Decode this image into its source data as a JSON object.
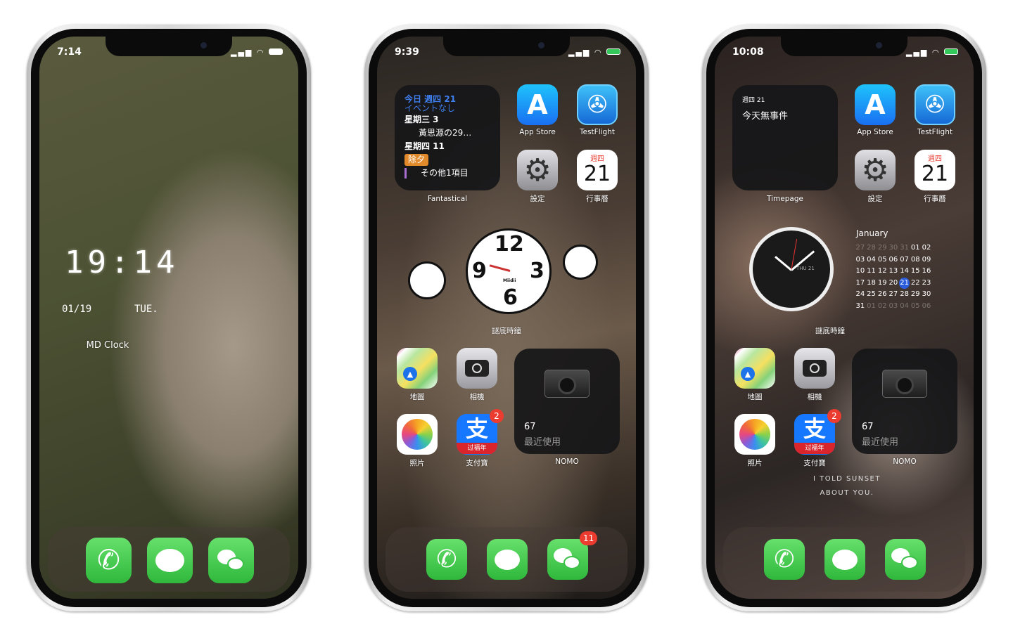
{
  "phones": [
    {
      "status_time": "7:14",
      "md_clock": {
        "time": "19:14",
        "date": "01/19",
        "weekday": "TUE.",
        "label": "MD Clock"
      },
      "dock": [
        {
          "icon": "phone-icon"
        },
        {
          "icon": "messages-icon"
        },
        {
          "icon": "wechat-icon"
        }
      ]
    },
    {
      "status_time": "9:39",
      "fantastical": {
        "today": "今日 週四 21",
        "no_events": "イベントなし",
        "day1": "星期三 3",
        "event1": "黃思源の29…",
        "day2": "星期四 11",
        "event2": "除夕",
        "more": "その他1項目",
        "label": "Fantastical"
      },
      "apps": {
        "appstore": "App Store",
        "testflight": "TestFlight",
        "settings": "設定",
        "calendar": "行事曆",
        "maps": "地圖",
        "camera": "相機",
        "photos": "照片",
        "alipay": "支付寶"
      },
      "calendar_icon": {
        "weekday": "週四",
        "day": "21"
      },
      "alipay_banner": "过福年",
      "alipay_badge": "2",
      "clock": {
        "label": "謎底時鐘",
        "brand": "Miidii",
        "n12": "12",
        "n3": "3",
        "n6": "6",
        "n9": "9"
      },
      "nomo": {
        "count": "67",
        "subtitle": "最近使用",
        "label": "NOMO"
      },
      "dock_badge": "11"
    },
    {
      "status_time": "10:08",
      "timepage": {
        "date": "週四 21",
        "text": "今天無事件",
        "label": "Timepage"
      },
      "apps": {
        "appstore": "App Store",
        "testflight": "TestFlight",
        "settings": "設定",
        "calendar": "行事曆",
        "maps": "地圖",
        "camera": "相機",
        "photos": "照片",
        "alipay": "支付寶"
      },
      "calendar_icon": {
        "weekday": "週四",
        "day": "21"
      },
      "alipay_banner": "过福年",
      "alipay_badge": "2",
      "clock": {
        "label": "謎底時鐘",
        "face_date": "THU 21",
        "month": "January",
        "weeks": [
          [
            "27",
            "28",
            "29",
            "30",
            "31",
            "01",
            "02"
          ],
          [
            "03",
            "04",
            "05",
            "06",
            "07",
            "08",
            "09"
          ],
          [
            "10",
            "11",
            "12",
            "13",
            "14",
            "15",
            "16"
          ],
          [
            "17",
            "18",
            "19",
            "20",
            "21",
            "22",
            "23"
          ],
          [
            "24",
            "25",
            "26",
            "27",
            "28",
            "29",
            "30"
          ],
          [
            "31",
            "01",
            "02",
            "03",
            "04",
            "05",
            "06"
          ]
        ],
        "today": "21"
      },
      "nomo": {
        "count": "67",
        "subtitle": "最近使用",
        "label": "NOMO"
      },
      "quote": [
        "I TOLD SUNSET",
        "ABOUT YOU."
      ]
    }
  ],
  "colors": {
    "accent_blue": "#3a7bf0",
    "badge_red": "#ec3c30",
    "calendar_red": "#e8372c",
    "green": "#34c759"
  }
}
